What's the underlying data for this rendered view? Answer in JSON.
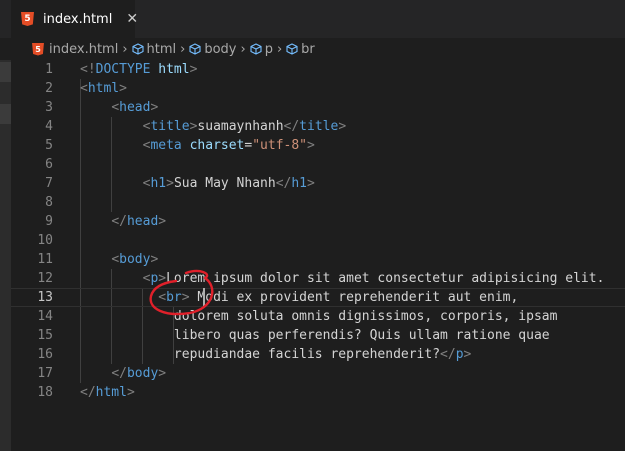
{
  "tab": {
    "label": "index.html",
    "icon": "html5-file-icon",
    "close": "✕"
  },
  "breadcrumb": [
    "index.html",
    "html",
    "body",
    "p",
    "br"
  ],
  "colors": {
    "tag": "#569cd6",
    "bracket": "#808080",
    "attribute": "#9cdcfe",
    "string": "#ce9178",
    "text": "#d4d4d4",
    "line_number": "#858585"
  },
  "editor": {
    "current_line": 13,
    "lines": [
      {
        "n": "1",
        "segs": [
          [
            "t",
            "<!"
          ],
          [
            "tn",
            "DOCTYPE"
          ],
          [
            "at",
            " html"
          ],
          [
            "t",
            ">"
          ]
        ]
      },
      {
        "n": "2",
        "segs": [
          [
            "t",
            "<"
          ],
          [
            "tn",
            "html"
          ],
          [
            "t",
            ">"
          ]
        ]
      },
      {
        "n": "3",
        "segs": [
          [
            "tx",
            "    "
          ],
          [
            "t",
            "<"
          ],
          [
            "tn",
            "head"
          ],
          [
            "t",
            ">"
          ]
        ]
      },
      {
        "n": "4",
        "segs": [
          [
            "tx",
            "        "
          ],
          [
            "t",
            "<"
          ],
          [
            "tn",
            "title"
          ],
          [
            "t",
            ">"
          ],
          [
            "tx",
            "suamaynhanh"
          ],
          [
            "t",
            "</"
          ],
          [
            "tn",
            "title"
          ],
          [
            "t",
            ">"
          ]
        ]
      },
      {
        "n": "5",
        "segs": [
          [
            "tx",
            "        "
          ],
          [
            "t",
            "<"
          ],
          [
            "tn",
            "meta"
          ],
          [
            "tx",
            " "
          ],
          [
            "at",
            "charset"
          ],
          [
            "tx",
            "="
          ],
          [
            "av",
            "\"utf-8\""
          ],
          [
            "t",
            ">"
          ]
        ]
      },
      {
        "n": "6",
        "segs": []
      },
      {
        "n": "7",
        "segs": [
          [
            "tx",
            "        "
          ],
          [
            "t",
            "<"
          ],
          [
            "tn",
            "h1"
          ],
          [
            "t",
            ">"
          ],
          [
            "tx",
            "Sua May Nhanh"
          ],
          [
            "t",
            "</"
          ],
          [
            "tn",
            "h1"
          ],
          [
            "t",
            ">"
          ]
        ]
      },
      {
        "n": "8",
        "segs": []
      },
      {
        "n": "9",
        "segs": [
          [
            "tx",
            "    "
          ],
          [
            "t",
            "</"
          ],
          [
            "tn",
            "head"
          ],
          [
            "t",
            ">"
          ]
        ]
      },
      {
        "n": "10",
        "segs": []
      },
      {
        "n": "11",
        "segs": [
          [
            "tx",
            "    "
          ],
          [
            "t",
            "<"
          ],
          [
            "tn",
            "body"
          ],
          [
            "t",
            ">"
          ]
        ]
      },
      {
        "n": "12",
        "segs": [
          [
            "tx",
            "        "
          ],
          [
            "t",
            "<"
          ],
          [
            "tn",
            "p"
          ],
          [
            "t",
            ">"
          ],
          [
            "tx",
            "Lorem ipsum dolor sit amet consectetur adipisicing elit."
          ]
        ]
      },
      {
        "n": "13",
        "segs": [
          [
            "tx",
            "          "
          ],
          [
            "t",
            "<"
          ],
          [
            "tn",
            "br"
          ],
          [
            "t",
            ">"
          ],
          [
            "tx",
            " Modi ex provident reprehenderit aut enim,"
          ]
        ]
      },
      {
        "n": "14",
        "segs": [
          [
            "tx",
            "            dolorem soluta omnis dignissimos, corporis, ipsam"
          ]
        ]
      },
      {
        "n": "15",
        "segs": [
          [
            "tx",
            "            libero quas perferendis? Quis ullam ratione quae"
          ]
        ]
      },
      {
        "n": "16",
        "segs": [
          [
            "tx",
            "            repudiandae facilis reprehenderit?"
          ],
          [
            "t",
            "</"
          ],
          [
            "tn",
            "p"
          ],
          [
            "t",
            ">"
          ]
        ]
      },
      {
        "n": "17",
        "segs": [
          [
            "tx",
            "    "
          ],
          [
            "t",
            "</"
          ],
          [
            "tn",
            "body"
          ],
          [
            "t",
            ">"
          ]
        ]
      },
      {
        "n": "18",
        "segs": [
          [
            "t",
            "</"
          ],
          [
            "tn",
            "html"
          ],
          [
            "t",
            ">"
          ]
        ]
      }
    ]
  }
}
